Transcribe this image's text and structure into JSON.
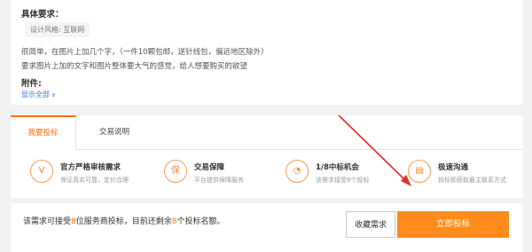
{
  "requirements": {
    "title": "具体要求：",
    "tag": "设计风格: 互联网",
    "line1": "很简单，在图片上加几个字，（一件10颗包邮，送针线包，偏远地区除外）",
    "line2": "要求图片上加的文字和图片整体要大气的感觉，给人想要购买的欲望",
    "attachments_label": "附件:",
    "show_all": "显示全部"
  },
  "tabs": [
    {
      "label": "我要投标",
      "active": true
    },
    {
      "label": "交易说明",
      "active": false
    }
  ],
  "features": [
    {
      "icon": "v-check-icon",
      "glyph": "V",
      "title": "官方严格审核需求",
      "desc": "保证真实可靠，定价合理"
    },
    {
      "icon": "shield-icon",
      "glyph": "保",
      "title": "交易保障",
      "desc": "平台提供保障服务"
    },
    {
      "icon": "chance-icon",
      "glyph": "◔",
      "title": "1/8中标机会",
      "desc": "该需求接受8个投标"
    },
    {
      "icon": "chat-icon",
      "glyph": "▤",
      "title": "极速沟通",
      "desc": "投标即获取雇主联系方式"
    }
  ],
  "bottom": {
    "text_a": "该需求可接受",
    "count_a": "8",
    "text_b": "位服务商投标，目前还剩余",
    "count_b": "8",
    "text_c": "个投标名额。",
    "fav_label": "收藏需求",
    "bid_label": "立即投标"
  },
  "colors": {
    "accent": "#ff6f0f",
    "button": "#ff8c1a",
    "arrow": "#e0312a"
  }
}
